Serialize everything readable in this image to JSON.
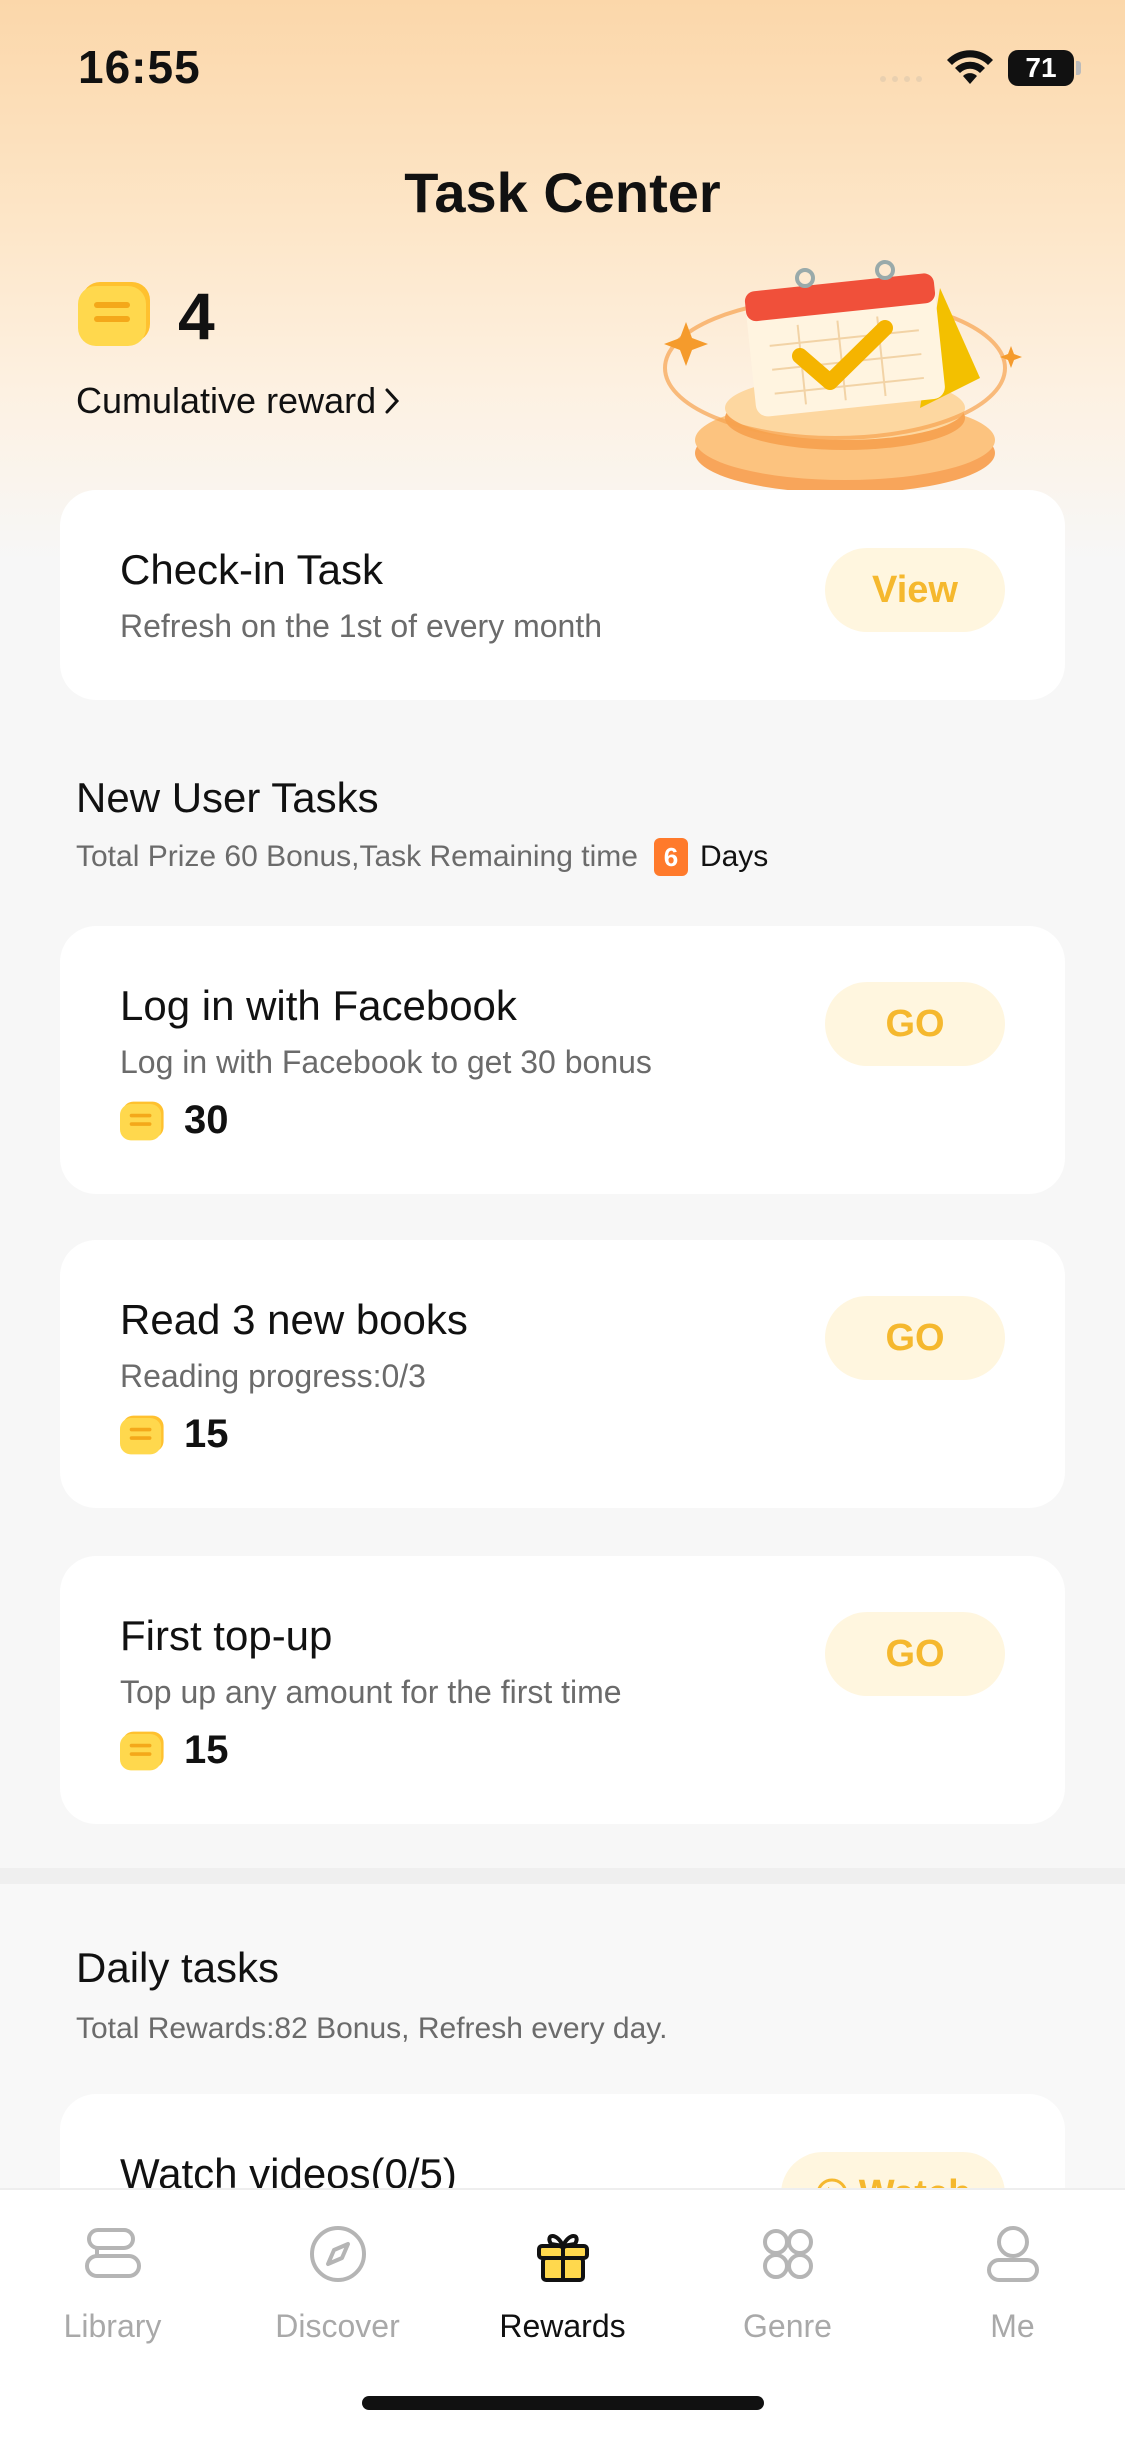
{
  "status_bar": {
    "time": "16:55",
    "battery": "71"
  },
  "header": {
    "title": "Task Center",
    "coin_count": "4",
    "cumulative_label": "Cumulative reward"
  },
  "checkin": {
    "title": "Check-in Task",
    "subtitle": "Refresh on the 1st of every month",
    "button": "View"
  },
  "new_user": {
    "title": "New User Tasks",
    "subtitle": "Total Prize 60 Bonus,Task Remaining time",
    "days_value": "6",
    "days_label": "Days",
    "tasks": [
      {
        "title": "Log in with Facebook",
        "subtitle": "Log in with Facebook to get 30 bonus",
        "reward": "30",
        "button": "GO"
      },
      {
        "title": "Read 3 new books",
        "subtitle": "Reading progress:0/3",
        "reward": "15",
        "button": "GO"
      },
      {
        "title": "First top-up",
        "subtitle": "Top up any amount for the first time",
        "reward": "15",
        "button": "GO"
      }
    ]
  },
  "daily": {
    "title": "Daily tasks",
    "subtitle": "Total Rewards:82 Bonus, Refresh every day.",
    "tasks": [
      {
        "title": "Watch videos(0/5)",
        "button": "Watch"
      }
    ]
  },
  "tab_bar": {
    "items": [
      {
        "label": "Library",
        "icon": "library-icon"
      },
      {
        "label": "Discover",
        "icon": "compass-icon"
      },
      {
        "label": "Rewards",
        "icon": "gift-icon"
      },
      {
        "label": "Genre",
        "icon": "grid-icon"
      },
      {
        "label": "Me",
        "icon": "person-icon"
      }
    ],
    "active": "Rewards"
  },
  "colors": {
    "accent": "#f5b82e",
    "button_bg": "#fff6df",
    "days_badge": "#ff7a2b"
  }
}
